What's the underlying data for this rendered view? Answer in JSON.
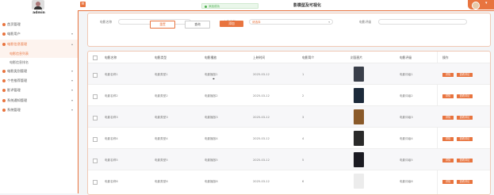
{
  "sidebar": {
    "username": "admin",
    "menu": [
      {
        "label": "首页管理",
        "open": false,
        "chev": ""
      },
      {
        "label": "电影用户",
        "open": false,
        "chev": "▾"
      },
      {
        "label": "电影信息管理",
        "open": true,
        "chev": "▴"
      },
      {
        "label": "电影类别管理",
        "open": false,
        "chev": "▾"
      },
      {
        "label": "个性推荐管理",
        "open": false,
        "chev": "▾"
      },
      {
        "label": "影评管理",
        "open": false,
        "chev": "▾"
      },
      {
        "label": "系统通知管理",
        "open": false,
        "chev": "▾"
      },
      {
        "label": "系统管理",
        "open": false,
        "chev": "▾"
      }
    ],
    "submenu": [
      {
        "label": "电影信息列表",
        "active": true
      },
      {
        "label": "电影信息排名",
        "active": false
      }
    ]
  },
  "topbar": {
    "hamburger": "≡",
    "toast": "添加成功",
    "title": "影模型及可视化"
  },
  "search": {
    "name_label": "电影名称",
    "type_label": "电影类型",
    "type_value": "请选择",
    "type_chev": "▾",
    "field3_label": "电影评级",
    "reset_label": "重置",
    "query_label": "查询",
    "add_label": "添加"
  },
  "table": {
    "headers": [
      "电影名称",
      "电影类型",
      "电影播放",
      "上映时间",
      "电影简介",
      "封面图片",
      "电影评级",
      "操作"
    ],
    "detail_label": "详情",
    "comment_label": "查看评论",
    "rows": [
      {
        "name": "电影名称1",
        "type": "电影类型1",
        "play": "电影播放1",
        "date": "2025-03-12",
        "intro": "1",
        "rating": "电影评级1",
        "cover": "#3a3f4a"
      },
      {
        "name": "电影名称2",
        "type": "电影类型2",
        "play": "电影播放2",
        "date": "2025-03-12",
        "intro": "2",
        "rating": "电影评级2",
        "cover": "#1c2a3a"
      },
      {
        "name": "电影名称3",
        "type": "电影类型3",
        "play": "电影播放3",
        "date": "2025-03-12",
        "intro": "3",
        "rating": "电影评级3",
        "cover": "#8a5a2a"
      },
      {
        "name": "电影名称4",
        "type": "电影类型4",
        "play": "电影播放4",
        "date": "2025-03-12",
        "intro": "4",
        "rating": "电影评级4",
        "cover": "#2a2a2a"
      },
      {
        "name": "电影名称5",
        "type": "电影类型5",
        "play": "电影播放5",
        "date": "2025-03-12",
        "intro": "5",
        "rating": "电影评级5",
        "cover": "#1a1a22"
      },
      {
        "name": "电影名称6",
        "type": "电影类型6",
        "play": "电影播放6",
        "date": "2025-03-12",
        "intro": "6",
        "rating": "电影评级6",
        "cover": "#ececec"
      }
    ]
  },
  "colors": {
    "accent": "#e8743f",
    "success": "#4caf50"
  }
}
